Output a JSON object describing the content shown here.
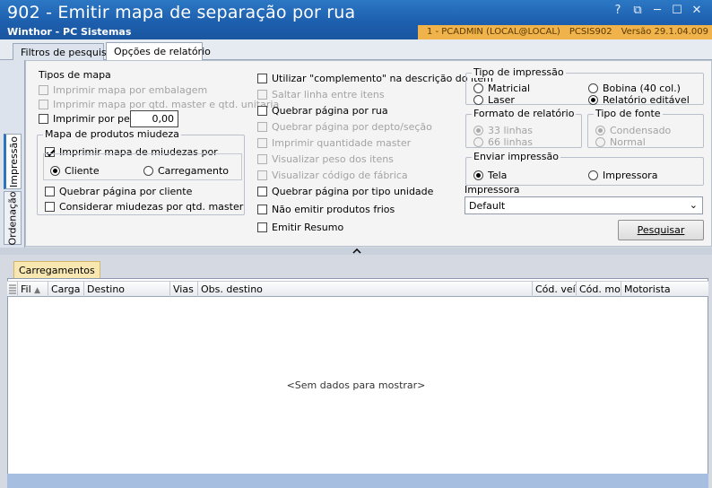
{
  "window": {
    "title": "902 - Emitir mapa de separação por rua",
    "subtitle": "Winthor - PC Sistemas",
    "buttons": [
      "?",
      "⧉",
      "─",
      "☐",
      "✕"
    ],
    "status": {
      "user": "1 - PCADMIN (LOCAL@LOCAL)",
      "routine": "PCSIS902",
      "version": "Versão  29.1.04.009"
    }
  },
  "tabs": [
    "Filtros de pesquisa",
    "Opções de relatório"
  ],
  "side_tabs": [
    "Impressão",
    "Ordenação"
  ],
  "tipos_mapa": {
    "title": "Tipos de mapa",
    "embalagem": "Imprimir mapa por embalagem",
    "master_unitaria": "Imprimir mapa por qtd. master e qtd. unitaria",
    "por_peso": "Imprimir por peso",
    "peso_value": "0,00"
  },
  "miudeza": {
    "title": "Mapa de produtos miudeza",
    "imprimir": "Imprimir mapa de miudezas por",
    "cliente": "Cliente",
    "carregamento": "Carregamento",
    "quebrar_cliente": "Quebrar página por cliente",
    "considerar_master": "Considerar miudezas por qtd. master"
  },
  "options": {
    "complemento": "Utilizar \"complemento\" na descrição do item",
    "saltar_linha": "Saltar linha entre itens",
    "quebrar_rua": "Quebrar página por rua",
    "quebrar_depto": "Quebrar página por depto/seção",
    "imprimir_master": "Imprimir quantidade master",
    "visualizar_peso": "Visualizar peso dos itens",
    "visualizar_codigo": "Visualizar código de fábrica",
    "quebrar_tipo": "Quebrar página por tipo unidade",
    "nao_frios": "Não emitir produtos frios",
    "emitir_resumo": "Emitir Resumo"
  },
  "tipo_impressao": {
    "title": "Tipo de impressão",
    "matricial": "Matricial",
    "bobina": "Bobina (40 col.)",
    "laser": "Laser",
    "editavel": "Relatório editável"
  },
  "formato": {
    "title": "Formato de relatório",
    "l33": "33 linhas",
    "l66": "66 linhas"
  },
  "fonte": {
    "title": "Tipo de fonte",
    "condensado": "Condensado",
    "normal": "Normal"
  },
  "enviar": {
    "title": "Enviar impressão",
    "tela": "Tela",
    "impressora": "Impressora"
  },
  "impressora": {
    "label": "Impressora",
    "value": "Default"
  },
  "pesquisar": "Pesquisar",
  "grid": {
    "tab": "Carregamentos",
    "columns": [
      "Fil",
      "Carga",
      "Destino",
      "Vias",
      "Obs. destino",
      "Cód. veíc",
      "Cód. mot",
      "Motorista"
    ],
    "empty": "<Sem dados para mostrar>"
  },
  "colors": {
    "titlebar": "#1d5fae",
    "status": "#f0b24a",
    "grid_tab": "#f8e7b0"
  }
}
